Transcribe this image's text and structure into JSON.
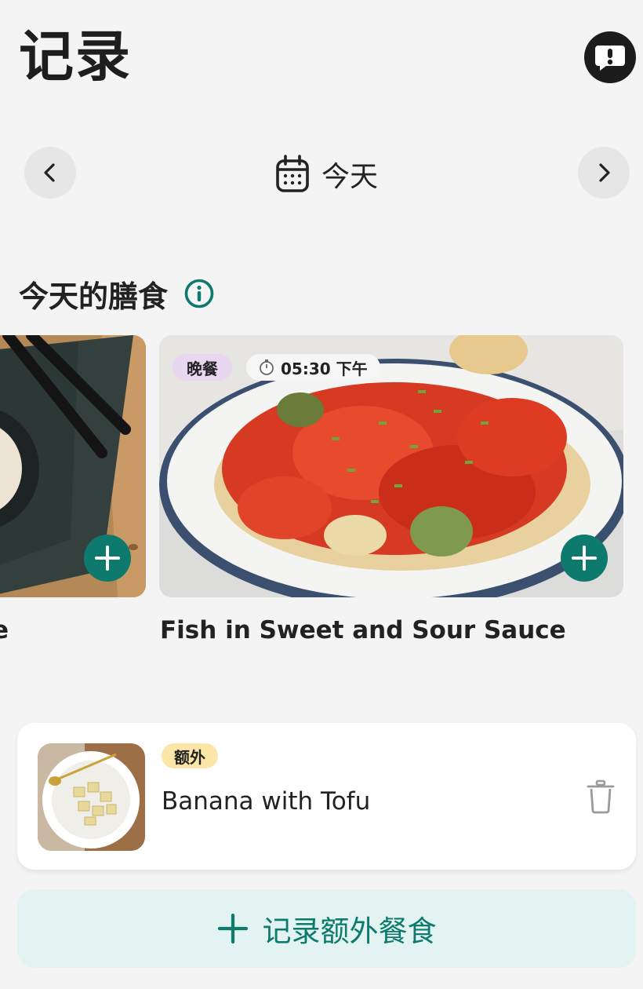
{
  "header": {
    "title": "记录",
    "feedback_icon": "feedback-exclamation-icon"
  },
  "date_nav": {
    "label": "今天",
    "prev_icon": "chevron-left-icon",
    "next_icon": "chevron-right-icon"
  },
  "section": {
    "title": "今天的膳食",
    "info_icon": "info-icon"
  },
  "meals": [
    {
      "name_fragment": "e"
    },
    {
      "tag": "晚餐",
      "time": "05:30 下午",
      "name": "Fish in Sweet and Sour Sauce"
    }
  ],
  "extra": {
    "tag": "额外",
    "name": "Banana with Tofu"
  },
  "log_extra": {
    "label": "记录额外餐食"
  },
  "colors": {
    "accent": "#0e7a6e",
    "accent_light": "#e2f3f1",
    "dinner_tag": "#e9d6f1",
    "extra_tag": "#fbe6a7",
    "background": "#f4f4f4"
  }
}
